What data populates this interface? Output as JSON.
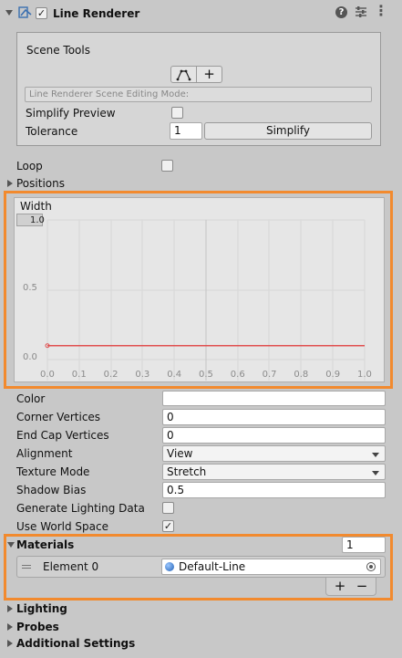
{
  "header": {
    "title": "Line Renderer",
    "enabled": true,
    "icons": [
      "line-renderer-icon",
      "help-icon",
      "presets-icon",
      "more-icon"
    ]
  },
  "scene_tools": {
    "title": "Scene Tools",
    "mode_placeholder": "Line Renderer Scene Editing Mode:",
    "simplify_preview_label": "Simplify Preview",
    "simplify_preview_checked": false,
    "tolerance_label": "Tolerance",
    "tolerance_value": "1",
    "simplify_button": "Simplify",
    "add_button": "+"
  },
  "loop": {
    "label": "Loop",
    "checked": false
  },
  "positions": {
    "label": "Positions"
  },
  "width_curve": {
    "title": "Width",
    "y_labels": [
      "1.0",
      "0.5",
      "0.0"
    ],
    "x_labels": [
      "0.0",
      "0.1",
      "0.2",
      "0.3",
      "0.4",
      "0.5",
      "0.6",
      "0.7",
      "0.8",
      "0.9",
      "1.0"
    ],
    "curve_value": 0.1,
    "curve_color": "#e05050"
  },
  "properties": {
    "color_label": "Color",
    "corner_vertices_label": "Corner Vertices",
    "corner_vertices_value": "0",
    "end_cap_vertices_label": "End Cap Vertices",
    "end_cap_vertices_value": "0",
    "alignment_label": "Alignment",
    "alignment_value": "View",
    "texture_mode_label": "Texture Mode",
    "texture_mode_value": "Stretch",
    "shadow_bias_label": "Shadow Bias",
    "shadow_bias_value": "0.5",
    "generate_lighting_label": "Generate Lighting Data",
    "generate_lighting_checked": false,
    "use_world_space_label": "Use World Space",
    "use_world_space_checked": true
  },
  "materials": {
    "label": "Materials",
    "size": "1",
    "element_label": "Element 0",
    "element_value": "Default-Line",
    "add": "+",
    "remove": "−"
  },
  "sections": {
    "lighting": "Lighting",
    "probes": "Probes",
    "additional": "Additional Settings"
  },
  "highlight_color": "#f28a2e"
}
